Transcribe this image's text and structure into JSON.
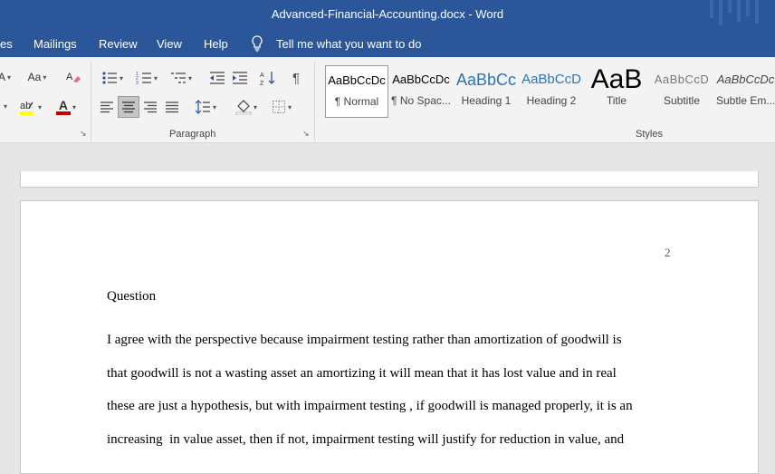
{
  "window": {
    "title": "Advanced-Financial-Accounting.docx  -  Word"
  },
  "menu": {
    "items": [
      "es",
      "Mailings",
      "Review",
      "View",
      "Help"
    ],
    "tell_me": "Tell me what you want to do"
  },
  "ribbon": {
    "font_group": {
      "change_case_label": "Aa",
      "font_color_label": "A",
      "font_color_bar": "#c00000",
      "highlight_bar": "#ffff00"
    },
    "paragraph_group": {
      "label": "Paragraph"
    },
    "styles_group": {
      "label": "Styles",
      "styles": [
        {
          "preview": "AaBbCcDc",
          "name": "¶ Normal",
          "selected": true
        },
        {
          "preview": "AaBbCcDc",
          "name": "¶ No Spac..."
        },
        {
          "preview": "AaBbCc",
          "name": "Heading 1"
        },
        {
          "preview": "AaBbCcD",
          "name": "Heading 2"
        },
        {
          "preview": "AaB",
          "name": "Title"
        },
        {
          "preview": "AaBbCcD",
          "name": "Subtitle"
        },
        {
          "preview": "AaBbCcDc",
          "name": "Subtle Em..."
        }
      ]
    }
  },
  "document": {
    "page_number": "2",
    "heading": "Question",
    "lines": [
      "I agree with the perspective because impairment testing rather than amortization of goodwill is",
      "that goodwill is not a wasting asset an amortizing it will mean that it has lost value and in real",
      "these are just a hypothesis, but with impairment testing , if goodwill is managed properly, it is an",
      "increasing  in value asset, then if not, impairment testing will justify for reduction in value, and"
    ]
  },
  "colors": {
    "title_bar": "#2b579a",
    "ribbon": "#f3f3f3",
    "canvas": "#e6e6e6",
    "heading1_blue": "#2e74b5",
    "heading2_blue": "#2e74b5"
  }
}
